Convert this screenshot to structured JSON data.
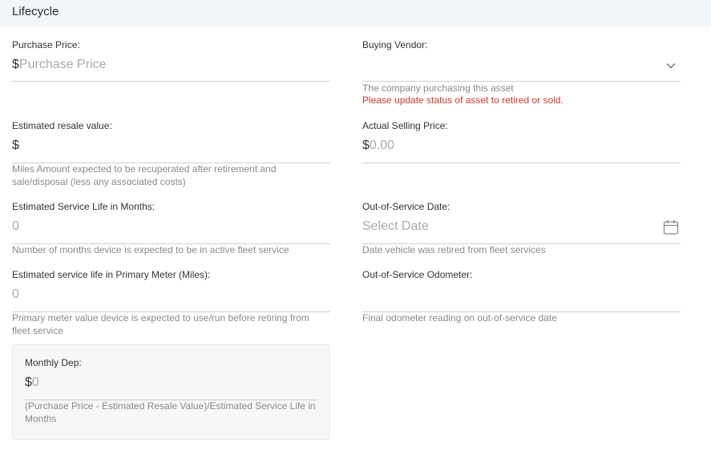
{
  "section": {
    "title": "Lifecycle"
  },
  "purchase_price": {
    "label": "Purchase Price:",
    "prefix": "$",
    "placeholder": "Purchase Price"
  },
  "buying_vendor": {
    "label": "Buying Vendor:",
    "help": "The company purchasing this asset",
    "error": "Please update status of asset to retired or sold.",
    "icon": "chevron-down-icon"
  },
  "resale_value": {
    "label": "Estimated resale value:",
    "prefix": "$",
    "help": "Miles Amount expected to be recuperated after retirement and sale/disposal (less any associated costs)"
  },
  "selling_price": {
    "label": "Actual Selling Price:",
    "prefix": "$",
    "placeholder": "0.00"
  },
  "service_life_months": {
    "label": "Estimated Service Life in Months:",
    "placeholder": "0",
    "help": "Number of months device is expected to be in active fleet service"
  },
  "out_of_service_date": {
    "label": "Out-of-Service Date:",
    "placeholder": "Select Date",
    "help": "Date vehicle was retired from fleet services",
    "icon": "calendar-icon"
  },
  "service_life_meter": {
    "label": "Estimated service life in Primary Meter (Miles):",
    "placeholder": "0",
    "help": "Primary meter value device is expected to use/run before retiring from fleet service"
  },
  "out_of_service_odometer": {
    "label": "Out-of-Service Odometer:",
    "help": "Final odometer reading on out-of-service date"
  },
  "monthly_dep": {
    "label": "Monthly Dep:",
    "prefix": "$",
    "placeholder": "0",
    "help": "(Purchase Price - Estimated Resale Value)/Estimated Service Life in Months"
  },
  "colors": {
    "header_bg": "#f2f6fa",
    "error": "#d23a2e",
    "line": "#cfcfcf"
  }
}
